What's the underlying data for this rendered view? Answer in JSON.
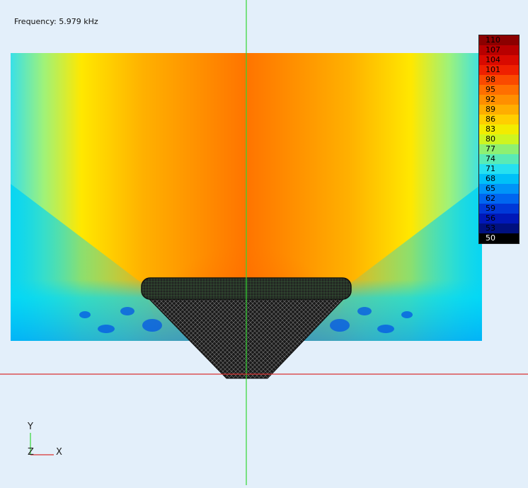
{
  "frequency_label": "Frequency: 5.979 kHz",
  "colorbar": {
    "values": [
      "110",
      "107",
      "104",
      "101",
      "98",
      "95",
      "92",
      "89",
      "86",
      "83",
      "80",
      "77",
      "74",
      "71",
      "68",
      "65",
      "62",
      "59",
      "56",
      "53",
      "50"
    ],
    "colors": [
      "#8c0000",
      "#b80000",
      "#d90a00",
      "#ef2000",
      "#fa4a00",
      "#ff6f00",
      "#ff8f00",
      "#ffae00",
      "#ffcf00",
      "#f2ec00",
      "#cef520",
      "#8ef072",
      "#59eab6",
      "#26e0f0",
      "#00c0f8",
      "#0094f8",
      "#0066f0",
      "#0038d8",
      "#0018b8",
      "#00107f",
      "#000000"
    ]
  },
  "axes_triad": {
    "y_label": "Y",
    "x_label": "X",
    "z_label": "Z"
  },
  "colors": {
    "background": "#e3effa",
    "green_axis": "#33d633",
    "red_axis": "#d93333"
  }
}
